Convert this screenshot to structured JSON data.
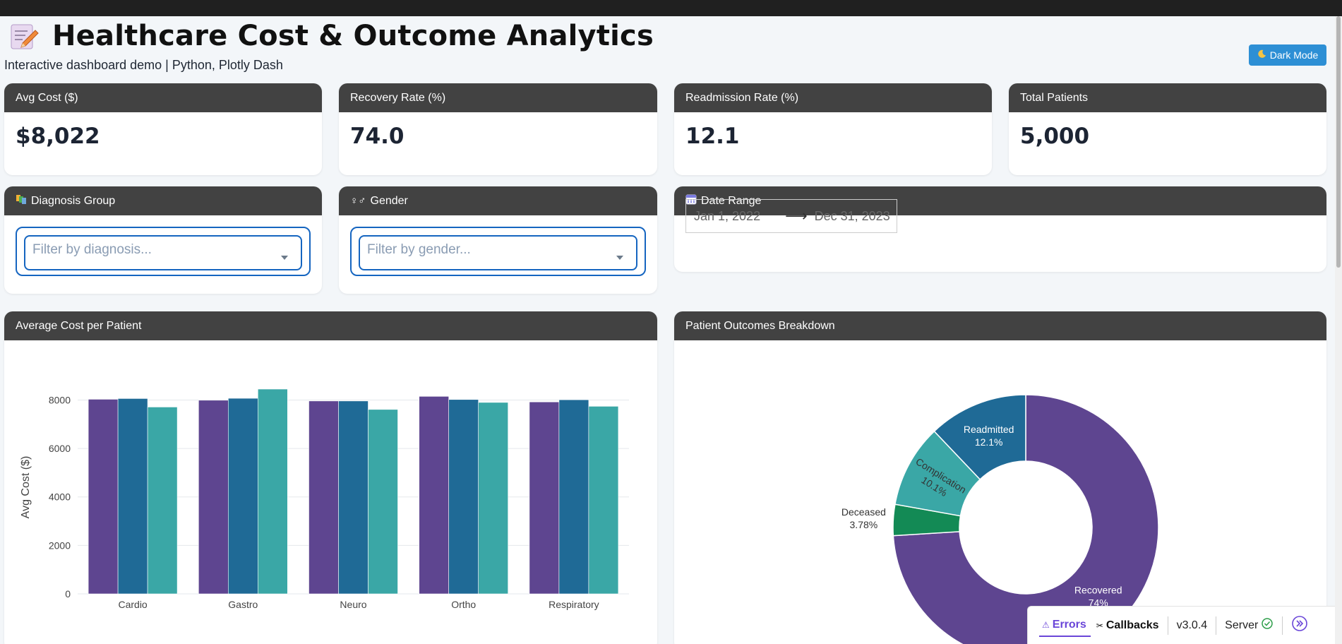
{
  "app": {
    "title": "Healthcare Cost & Outcome Analytics",
    "subtitle": "Interactive dashboard demo | Python, Plotly Dash",
    "dark_mode_label": "Dark Mode"
  },
  "kpis": [
    {
      "label": "Avg Cost ($)",
      "value": "$8,022"
    },
    {
      "label": "Recovery Rate (%)",
      "value": "74.0"
    },
    {
      "label": "Readmission Rate (%)",
      "value": "12.1"
    },
    {
      "label": "Total Patients",
      "value": "5,000"
    }
  ],
  "filters": {
    "diagnosis": {
      "label": "Diagnosis Group",
      "placeholder": "Filter by diagnosis...",
      "icon": "folder-icon"
    },
    "gender": {
      "label": "Gender",
      "placeholder": "Filter by gender...",
      "icon": "gender-icon"
    },
    "date": {
      "label": "Date Range",
      "start": "Jan 1, 2022",
      "end": "Dec 31, 2023",
      "icon": "calendar-icon"
    }
  },
  "panels": {
    "bar_title": "Average Cost per Patient",
    "pie_title": "Patient Outcomes Breakdown"
  },
  "chart_data": [
    {
      "type": "bar",
      "title": "",
      "xlabel": "",
      "ylabel": "Avg Cost ($)",
      "categories": [
        "Cardio",
        "Gastro",
        "Neuro",
        "Ortho",
        "Respiratory"
      ],
      "ylim": [
        0,
        8800
      ],
      "yticks": [
        0,
        2000,
        4000,
        6000,
        8000
      ],
      "colors": [
        "#5e4590",
        "#1f6a96",
        "#3aa7a6"
      ],
      "series": [
        {
          "values": [
            8030,
            7990,
            7960,
            8150,
            7920
          ]
        },
        {
          "values": [
            8060,
            8070,
            7960,
            8020,
            8010
          ]
        },
        {
          "values": [
            7710,
            8450,
            7610,
            7900,
            7740
          ]
        }
      ]
    },
    {
      "type": "pie",
      "title": "",
      "hole": 0.5,
      "labels": [
        "Recovered",
        "Deceased",
        "Complication",
        "Readmitted"
      ],
      "values": [
        74.0,
        3.78,
        10.1,
        12.1
      ],
      "display": [
        "74%",
        "3.78%",
        "10.1%",
        "12.1%"
      ],
      "colors": [
        "#5e4590",
        "#138a55",
        "#3aa7a6",
        "#1f6a96"
      ]
    }
  ],
  "status_bar": {
    "errors": "Errors",
    "callbacks": "Callbacks",
    "version": "v3.0.4",
    "server": "Server"
  }
}
